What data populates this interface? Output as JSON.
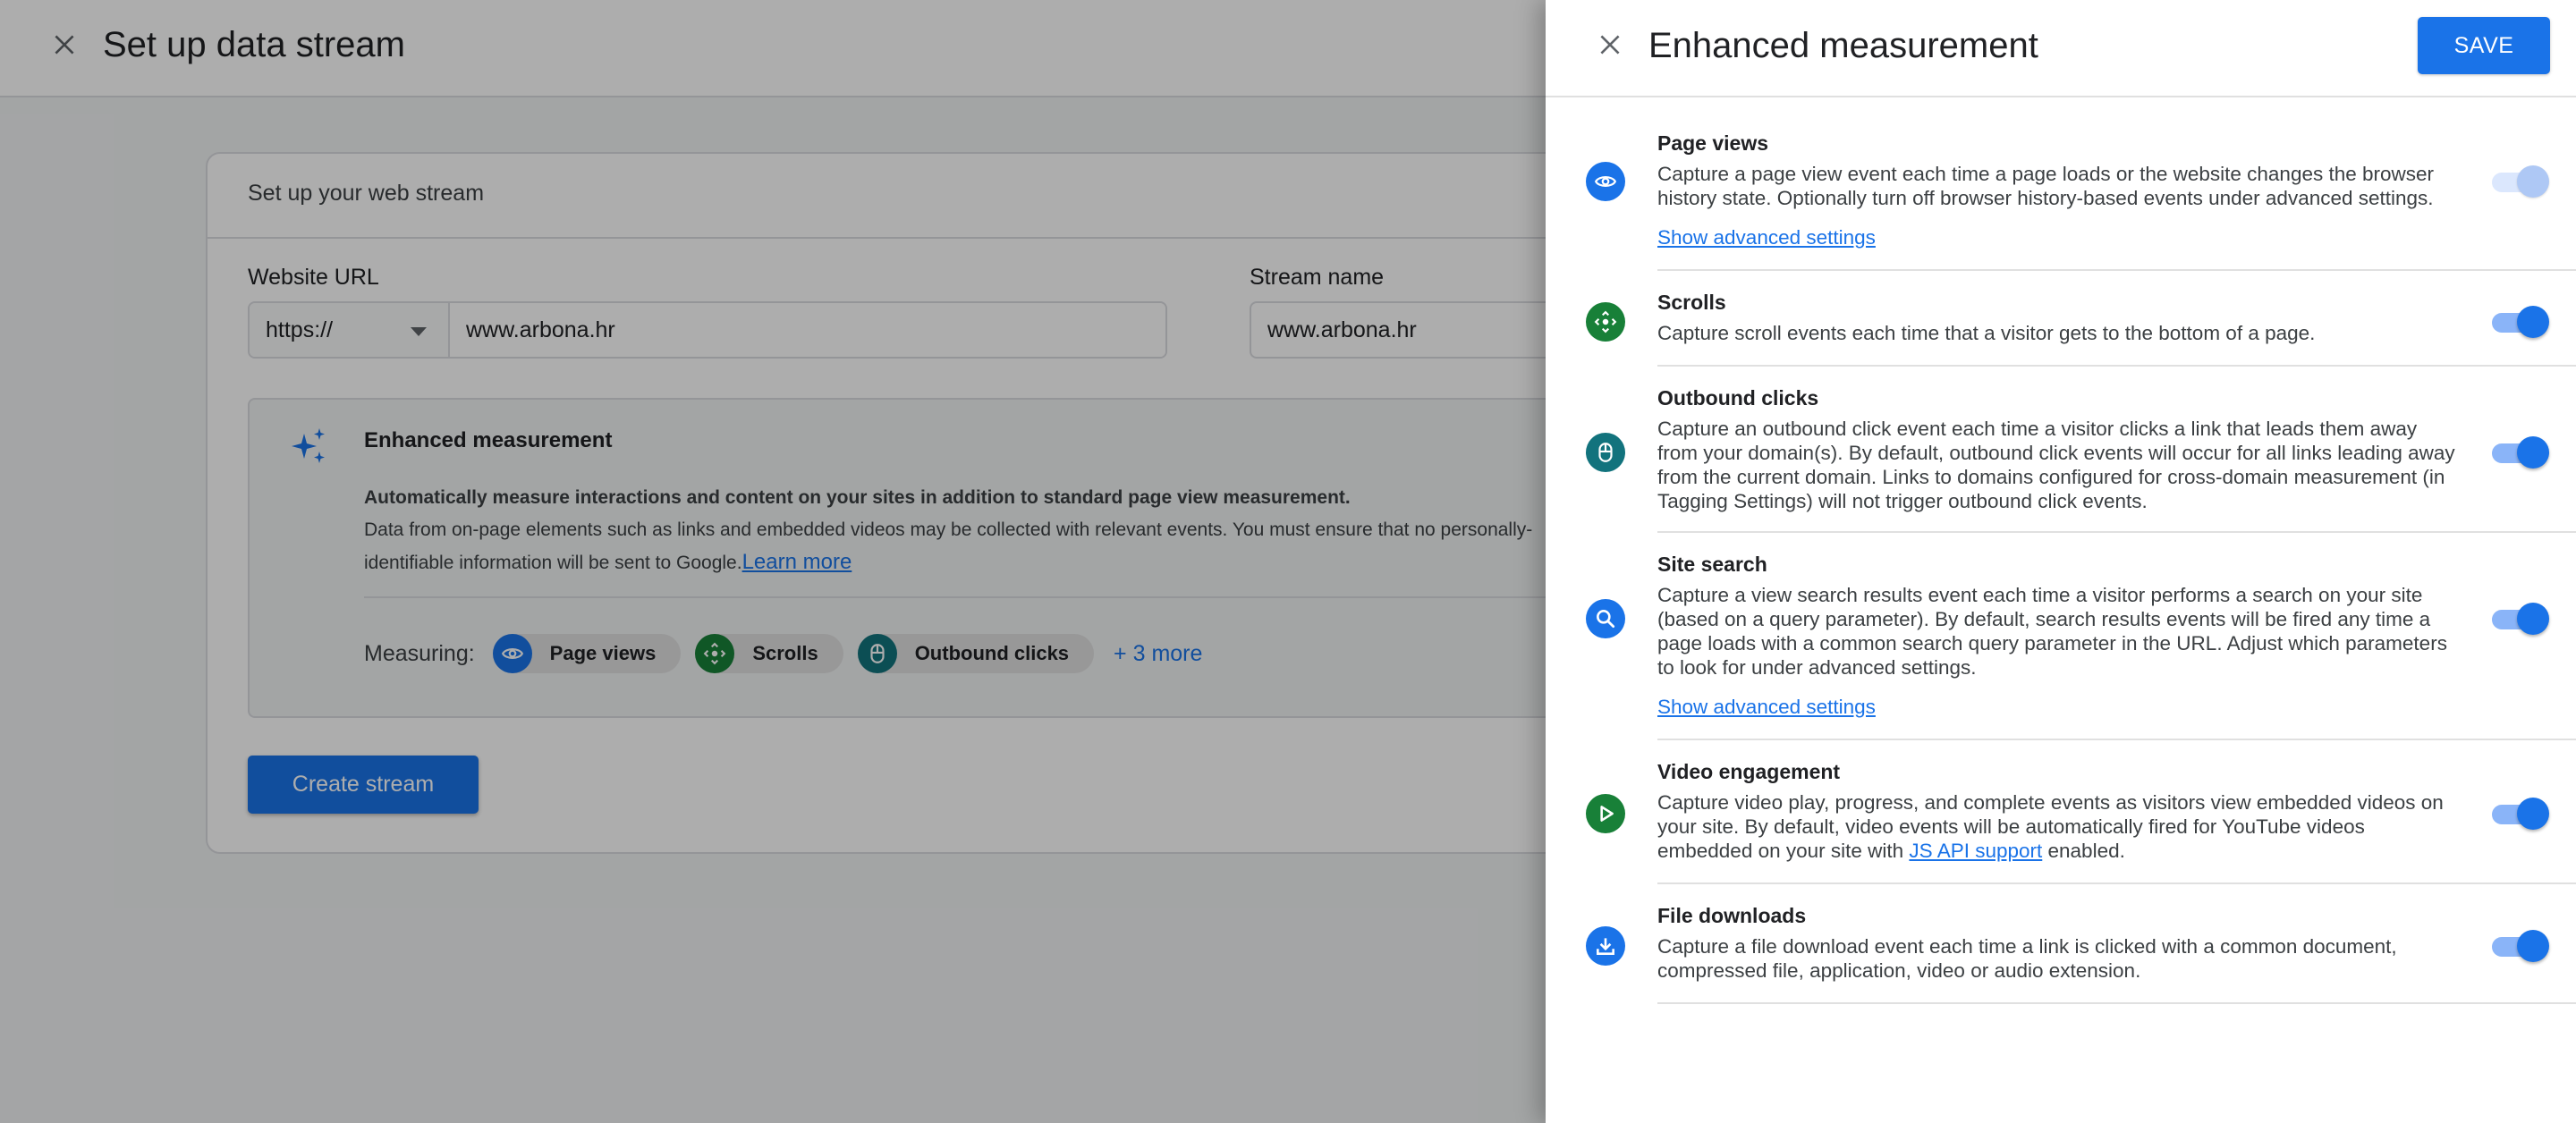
{
  "background": {
    "header": {
      "title": "Set up data stream",
      "close_icon": "close-icon"
    },
    "card": {
      "title": "Set up your web stream",
      "website_url": {
        "label": "Website URL",
        "protocol": "https://",
        "value": "www.arbona.hr"
      },
      "stream_name": {
        "label": "Stream name",
        "value": "www.arbona.hr"
      },
      "enhanced": {
        "title": "Enhanced measurement",
        "icon": "sparkle-icon",
        "description_bold": "Automatically measure interactions and content on your sites in addition to standard page view measurement.",
        "description": "Data from on-page elements such as links and embedded videos may be collected with relevant events. You must ensure that no personally-identifiable information will be sent to Google.",
        "learn_more": "Learn more",
        "measuring_label": "Measuring:",
        "chips": [
          {
            "label": "Page views",
            "icon": "eye-icon",
            "color": "#1a73e8"
          },
          {
            "label": "Scrolls",
            "icon": "scroll-icon",
            "color": "#188038"
          },
          {
            "label": "Outbound clicks",
            "icon": "mouse-icon",
            "color": "#12737d"
          }
        ],
        "more_label": "+ 3 more"
      },
      "create_button": "Create stream"
    }
  },
  "panel": {
    "title": "Enhanced measurement",
    "save_label": "SAVE",
    "items": [
      {
        "title": "Page views",
        "icon": "eye-icon",
        "color": "#1a73e8",
        "description": "Capture a page view event each time a page loads or the website changes the browser history state. Optionally turn off browser history-based events under advanced settings.",
        "advanced_link": "Show advanced settings",
        "enabled": true,
        "toggle_disabled": true
      },
      {
        "title": "Scrolls",
        "icon": "scroll-icon",
        "color": "#188038",
        "description": "Capture scroll events each time that a visitor gets to the bottom of a page.",
        "enabled": true,
        "toggle_disabled": false
      },
      {
        "title": "Outbound clicks",
        "icon": "mouse-icon",
        "color": "#12737d",
        "description": "Capture an outbound click event each time a visitor clicks a link that leads them away from your domain(s). By default, outbound click events will occur for all links leading away from the current domain. Links to domains configured for cross-domain measurement (in Tagging Settings) will not trigger outbound click events.",
        "enabled": true,
        "toggle_disabled": false
      },
      {
        "title": "Site search",
        "icon": "search-icon",
        "color": "#1a73e8",
        "description": "Capture a view search results event each time a visitor performs a search on your site (based on a query parameter). By default, search results events will be fired any time a page loads with a common search query parameter in the URL. Adjust which parameters to look for under advanced settings.",
        "advanced_link": "Show advanced settings",
        "enabled": true,
        "toggle_disabled": false
      },
      {
        "title": "Video engagement",
        "icon": "play-icon",
        "color": "#188038",
        "description_before": "Capture video play, progress, and complete events as visitors view embedded videos on your site. By default, video events will be automatically fired for YouTube videos embedded on your site with ",
        "description_link": "JS API support",
        "description_after": " enabled.",
        "enabled": true,
        "toggle_disabled": false
      },
      {
        "title": "File downloads",
        "icon": "download-icon",
        "color": "#1a73e8",
        "description": "Capture a file download event each time a link is clicked with a common document, compressed file, application, video or audio extension.",
        "enabled": true,
        "toggle_disabled": false
      }
    ]
  }
}
